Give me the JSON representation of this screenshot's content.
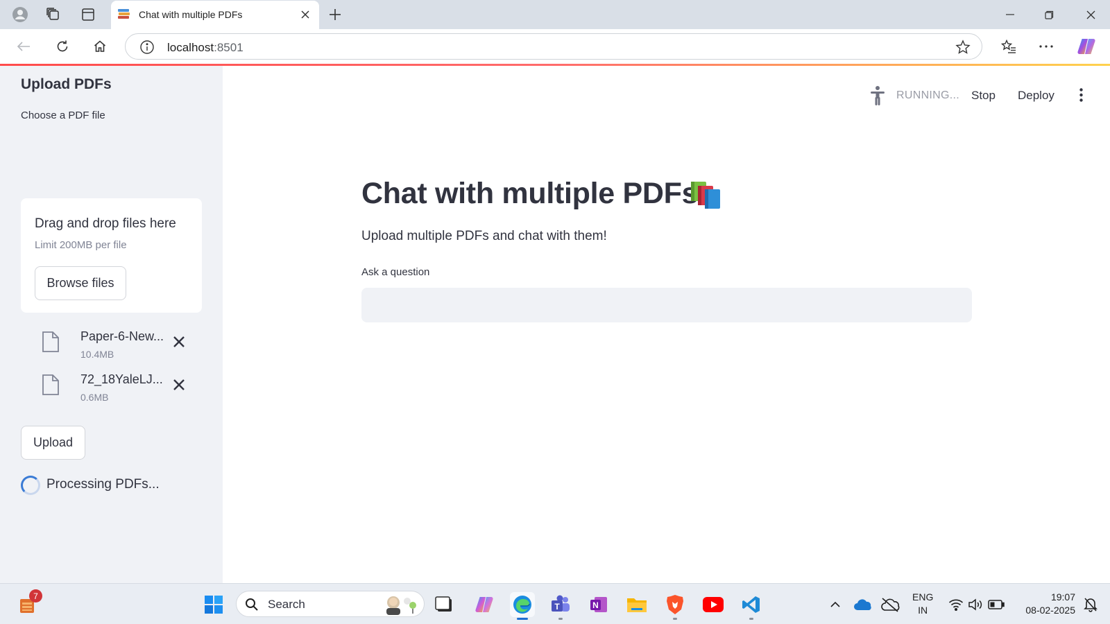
{
  "browser": {
    "tab_title": "Chat with multiple PDFs",
    "url_host": "localhost",
    "url_port": ":8501"
  },
  "sidebar": {
    "title": "Upload PDFs",
    "uploader_label": "Choose a PDF file",
    "dropzone_title": "Drag and drop files here",
    "dropzone_limit": "Limit 200MB per file",
    "browse_label": "Browse files",
    "files": [
      {
        "name": "Paper-6-New...",
        "size": "10.4MB"
      },
      {
        "name": "72_18YaleLJ...",
        "size": "0.6MB"
      }
    ],
    "upload_label": "Upload",
    "processing_text": "Processing PDFs..."
  },
  "header": {
    "status": "RUNNING...",
    "stop_label": "Stop",
    "deploy_label": "Deploy"
  },
  "main": {
    "title": "Chat with multiple PDFs",
    "title_icon": "books-icon",
    "subtitle": "Upload multiple PDFs and chat with them!",
    "question_label": "Ask a question",
    "question_value": ""
  },
  "taskbar": {
    "store_badge": "7",
    "search_label": "Search",
    "lang_line1": "ENG",
    "lang_line2": "IN",
    "time": "19:07",
    "date": "08-02-2025"
  },
  "colors": {
    "accent": "#ff4b4b",
    "sidebar_bg": "#f0f2f6",
    "text": "#31333f",
    "muted": "#808495"
  }
}
